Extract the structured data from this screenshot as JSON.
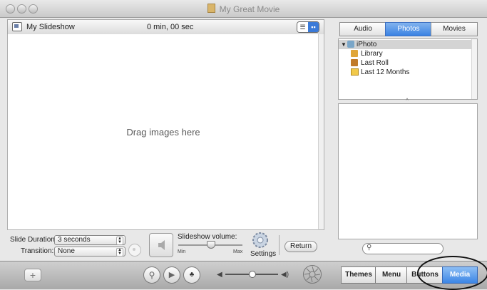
{
  "window": {
    "title": "My Great Movie"
  },
  "slideshow": {
    "name": "My Slideshow",
    "duration": "0 min, 00 sec",
    "drop_hint": "Drag images here"
  },
  "controls": {
    "slide_duration_label": "Slide Duration:",
    "slide_duration_value": "3 seconds",
    "transition_label": "Transition:",
    "transition_value": "None",
    "volume_label": "Slideshow volume:",
    "volume_min": "Min",
    "volume_max": "Max",
    "volume_level": 0.5,
    "settings_label": "Settings",
    "return_label": "Return"
  },
  "media_tabs": [
    {
      "label": "Audio",
      "selected": false
    },
    {
      "label": "Photos",
      "selected": true
    },
    {
      "label": "Movies",
      "selected": false
    }
  ],
  "library_tree": [
    {
      "label": "iPhoto",
      "icon": "iphoto-icon",
      "expanded": true
    },
    {
      "label": "Library",
      "icon": "library-icon"
    },
    {
      "label": "Last Roll",
      "icon": "roll-icon"
    },
    {
      "label": "Last 12 Months",
      "icon": "calendar-folder-icon"
    }
  ],
  "search": {
    "placeholder": ""
  },
  "bottom_segments": [
    {
      "label": "Themes",
      "selected": false
    },
    {
      "label": "Menu",
      "selected": false
    },
    {
      "label": "Buttons",
      "selected": false
    },
    {
      "label": "Media",
      "selected": true
    }
  ],
  "colors": {
    "accent_blue": "#3c86e6",
    "window_bg": "#e8e8e8"
  }
}
